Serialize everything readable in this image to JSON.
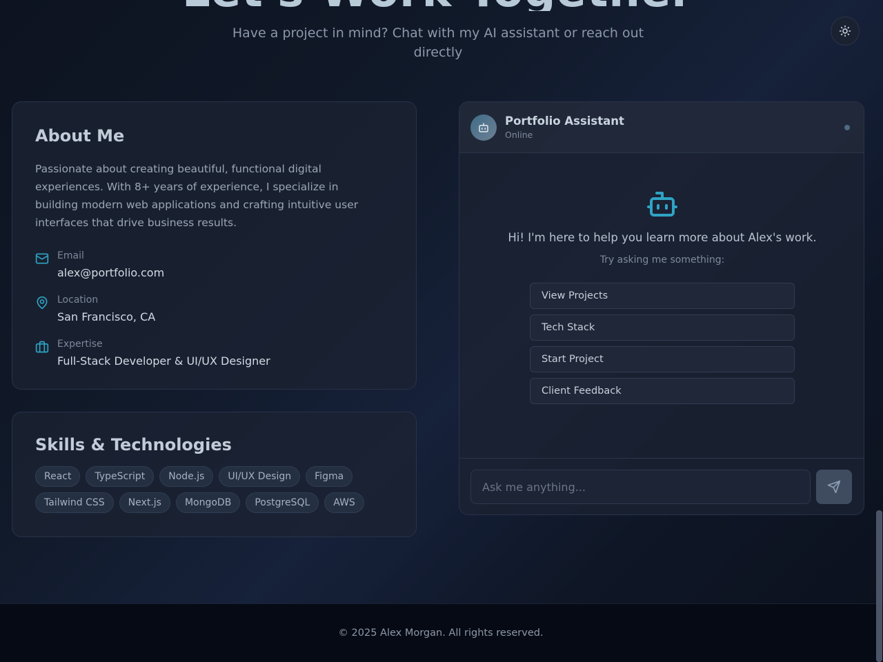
{
  "hero": {
    "title": "Let's Work Together",
    "subtitle": "Have a project in mind? Chat with my AI assistant or reach out directly"
  },
  "theme_toggle": {
    "icon": "sun-icon"
  },
  "about": {
    "heading": "About Me",
    "text": "Passionate about creating beautiful, functional digital experiences. With 8+ years of experience, I specialize in building modern web applications and crafting intuitive user interfaces that drive business results.",
    "info": [
      {
        "icon": "mail-icon",
        "label": "Email",
        "value": "alex@portfolio.com"
      },
      {
        "icon": "map-pin-icon",
        "label": "Location",
        "value": "San Francisco, CA"
      },
      {
        "icon": "briefcase-icon",
        "label": "Expertise",
        "value": "Full-Stack Developer & UI/UX Designer"
      }
    ]
  },
  "skills": {
    "heading": "Skills & Technologies",
    "items": [
      "React",
      "TypeScript",
      "Node.js",
      "UI/UX Design",
      "Figma",
      "Tailwind CSS",
      "Next.js",
      "MongoDB",
      "PostgreSQL",
      "AWS"
    ]
  },
  "chat": {
    "name": "Portfolio Assistant",
    "status": "Online",
    "greeting": "Hi! I'm here to help you learn more about Alex's work.",
    "prompt": "Try asking me something:",
    "suggestions": [
      "View Projects",
      "Tech Stack",
      "Start Project",
      "Client Feedback"
    ],
    "input_placeholder": "Ask me anything...",
    "input_value": ""
  },
  "footer": {
    "text": "© 2025 Alex Morgan. All rights reserved."
  },
  "colors": {
    "accent": "#2fa3c4",
    "background": "#0f1727",
    "card": "#1b2232"
  }
}
